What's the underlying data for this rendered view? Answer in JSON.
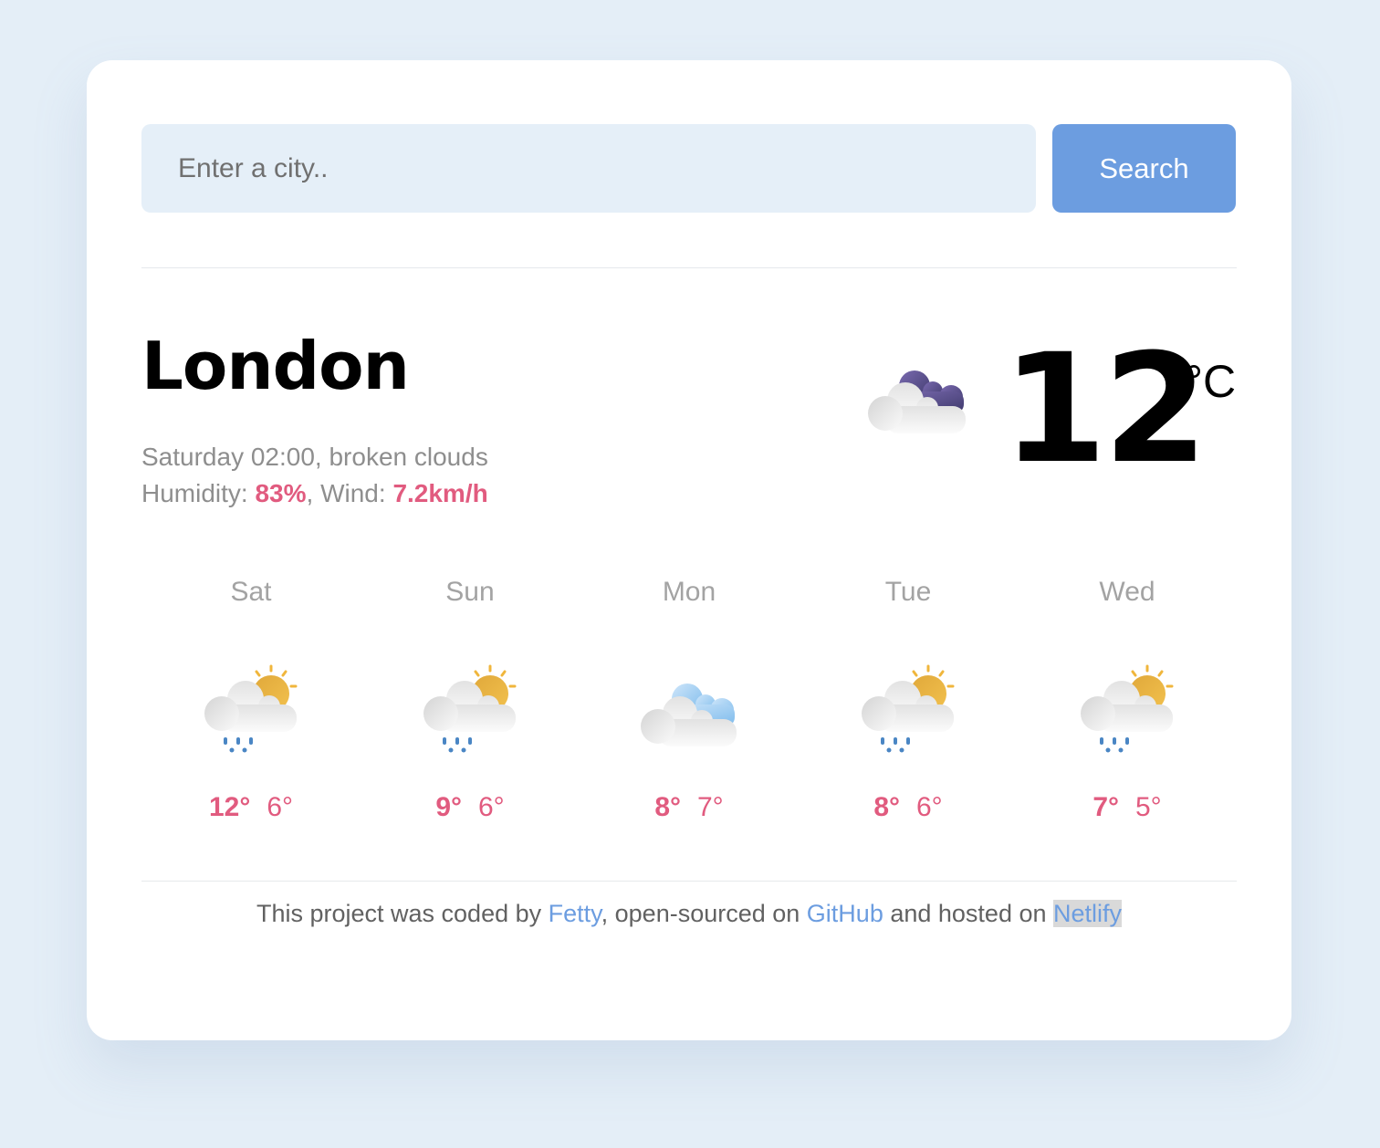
{
  "search": {
    "placeholder": "Enter a city..",
    "value": "",
    "button_label": "Search"
  },
  "current": {
    "city": "London",
    "day_time": "Saturday 02:00",
    "description": "broken clouds",
    "humidity_label": "Humidity: ",
    "humidity": "83%",
    "wind_label": ", Wind: ",
    "wind": "7.2km/h",
    "temperature": "12",
    "unit": "°C",
    "icon": "broken-clouds-night-icon"
  },
  "forecast": [
    {
      "day": "Sat",
      "max": "12°",
      "min": "6°",
      "icon": "rain-sun-icon"
    },
    {
      "day": "Sun",
      "max": "9°",
      "min": "6°",
      "icon": "rain-sun-icon"
    },
    {
      "day": "Mon",
      "max": "8°",
      "min": "7°",
      "icon": "clouds-icon"
    },
    {
      "day": "Tue",
      "max": "8°",
      "min": "6°",
      "icon": "rain-sun-icon"
    },
    {
      "day": "Wed",
      "max": "7°",
      "min": "5°",
      "icon": "rain-sun-icon"
    }
  ],
  "footer": {
    "text1": "This project was coded by ",
    "author": "Fetty",
    "text2": ", open-sourced on ",
    "repo": "GitHub",
    "text3": " and hosted on ",
    "host": "Netlify"
  },
  "colors": {
    "accent": "#6c9de0",
    "highlight": "#e15b7f",
    "background": "#e4eef7"
  }
}
